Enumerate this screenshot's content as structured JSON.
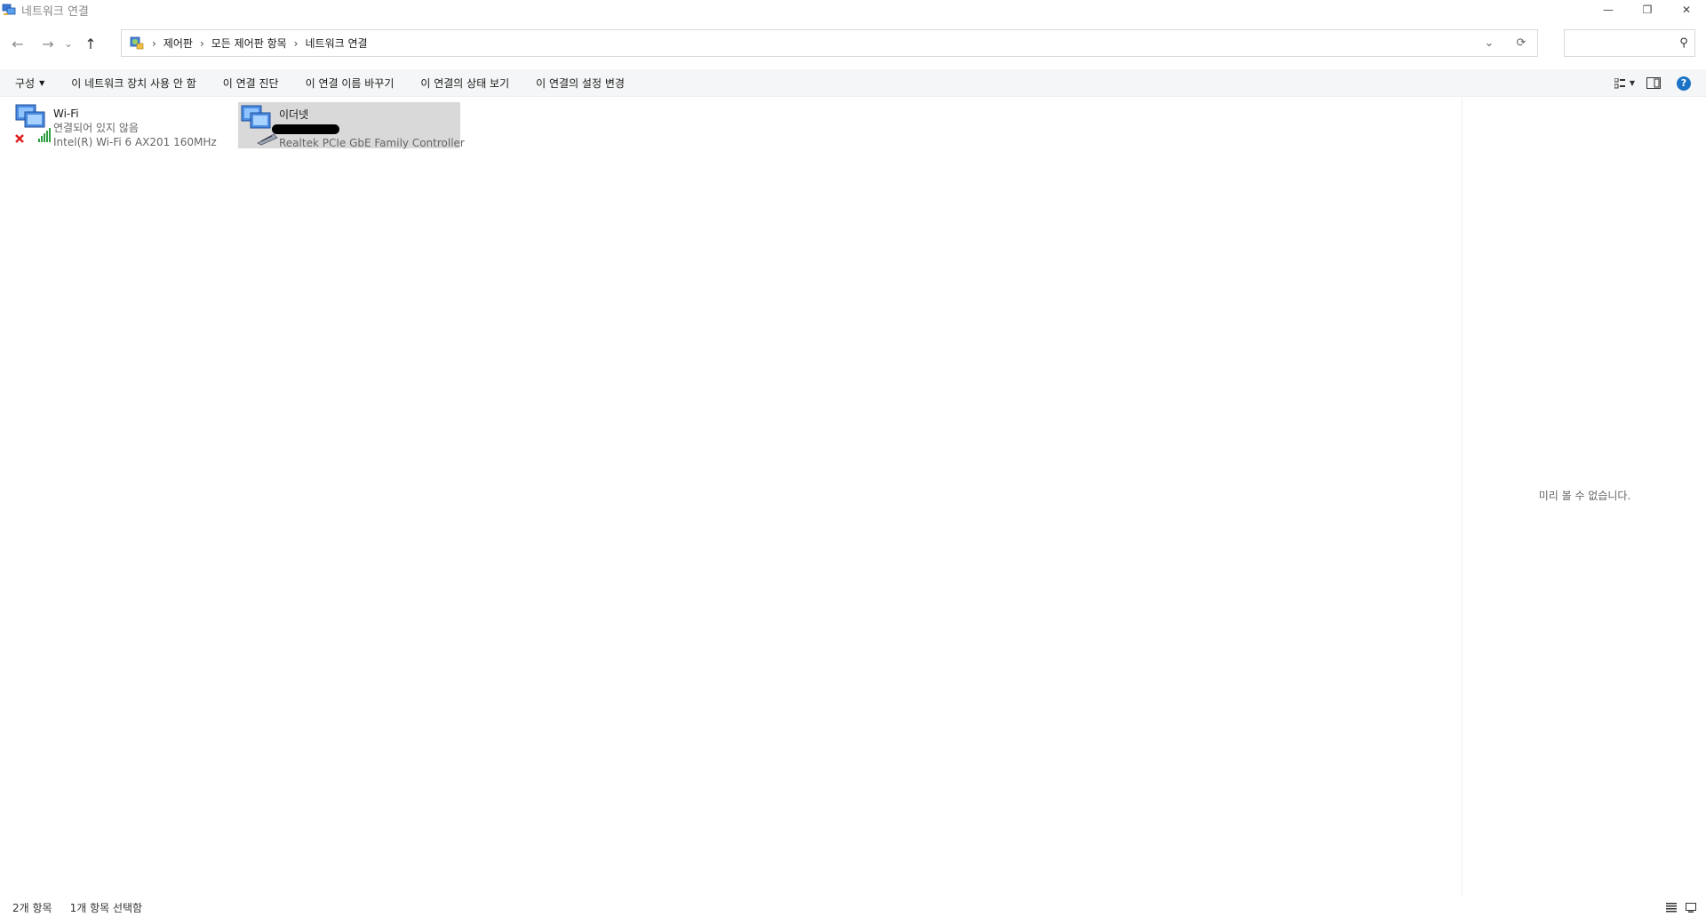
{
  "window": {
    "title": "네트워크 연결",
    "controls": [
      "—",
      "❐",
      "✕"
    ]
  },
  "nav": {
    "back": "←",
    "forward": "→",
    "recent": "⌄",
    "up": "↑",
    "breadcrumb": [
      "제어판",
      "모든 제어판 항목",
      "네트워크 연결"
    ],
    "search_placeholder": ""
  },
  "commands": [
    "구성",
    "이 네트워크 장치 사용 안 함",
    "이 연결 진단",
    "이 연결 이름 바꾸기",
    "이 연결의 상태 보기",
    "이 연결의 설정 변경"
  ],
  "connections": [
    {
      "name": "Wi-Fi",
      "status": "연결되어 있지 않음",
      "device": "Intel(R) Wi-Fi 6 AX201 160MHz",
      "selected": false
    },
    {
      "name": "이더넷",
      "status": "",
      "device": "Realtek PCIe GbE Family Controller",
      "selected": true
    }
  ],
  "preview": {
    "message": "미리 볼 수 없습니다."
  },
  "status": {
    "item_count": "2개 항목",
    "selected_count": "1개 항목 선택함"
  },
  "colors": {
    "selection": "#d9d9d9",
    "help": "#1b73c7",
    "error": "#e02020",
    "signal": "#2ea043"
  }
}
